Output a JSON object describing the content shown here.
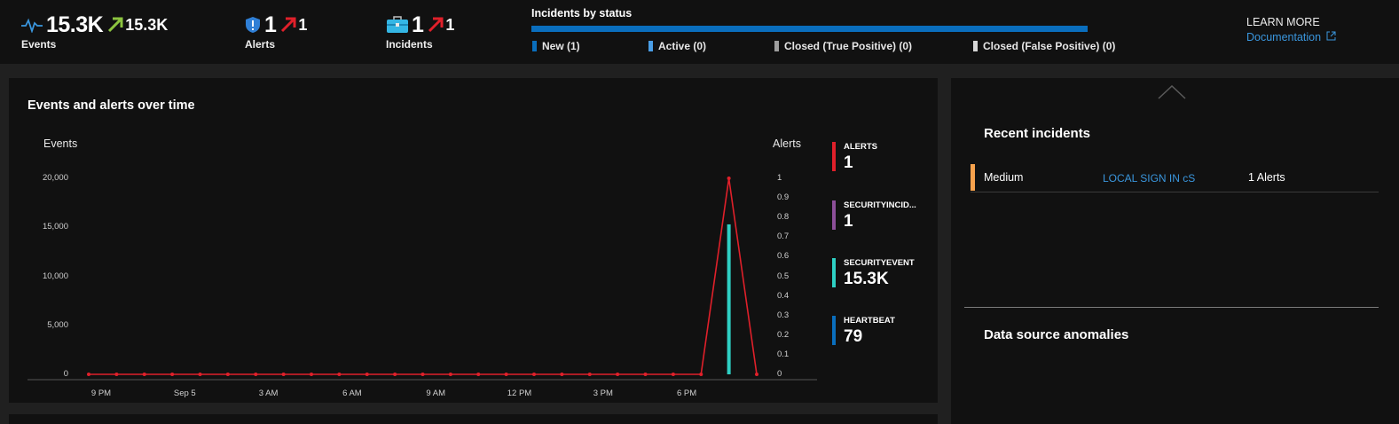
{
  "metrics": {
    "events": {
      "value": "15.3K",
      "delta": "15.3K",
      "label": "Events",
      "icon": "activity-pulse-icon"
    },
    "alerts": {
      "value": "1",
      "delta": "1",
      "label": "Alerts",
      "icon": "shield-alert-icon"
    },
    "incidents": {
      "value": "1",
      "delta": "1",
      "label": "Incidents",
      "icon": "briefcase-icon"
    }
  },
  "incidents_by_status": {
    "title": "Incidents by status",
    "items": [
      {
        "label": "New (1)",
        "color": "#0a6ebd"
      },
      {
        "label": "Active (0)",
        "color": "#4a9ee6"
      },
      {
        "label": "Closed (True Positive) (0)",
        "color": "#9e9e9e"
      },
      {
        "label": "Closed (False Positive) (0)",
        "color": "#d6d6d6"
      }
    ]
  },
  "learn_more": {
    "title": "LEARN MORE",
    "link": "Documentation",
    "icon": "external-link-icon"
  },
  "events_chart": {
    "title": "Events and alerts over time",
    "left_axis_label": "Events",
    "right_axis_label": "Alerts",
    "legend": [
      {
        "name": "ALERTS",
        "value": "1",
        "color": "#e0202a"
      },
      {
        "name": "SECURITYINCID...",
        "value": "1",
        "color": "#8c4f99"
      },
      {
        "name": "SECURITYEVENT",
        "value": "15.3K",
        "color": "#2ed0c4"
      },
      {
        "name": "HEARTBEAT",
        "value": "79",
        "color": "#0a6ebd"
      }
    ]
  },
  "chart_data": {
    "type": "line",
    "title": "Events and alerts over time",
    "ylabel_left": "Events",
    "ylabel_right": "Alerts",
    "x_tick_labels": [
      "9 PM",
      "Sep 5",
      "3 AM",
      "6 AM",
      "9 AM",
      "12 PM",
      "3 PM",
      "6 PM"
    ],
    "left_ticks": [
      "20,000",
      "15,000",
      "10,000",
      "5,000",
      "0"
    ],
    "right_ticks": [
      "1",
      "0.9",
      "0.8",
      "0.7",
      "0.6",
      "0.5",
      "0.4",
      "0.3",
      "0.2",
      "0.1",
      "0"
    ],
    "ylim_left": [
      0,
      20000
    ],
    "ylim_right": [
      0,
      1
    ],
    "grid": false,
    "legend_position": "right",
    "series": [
      {
        "name": "ALERTS",
        "axis": "right",
        "type": "line",
        "color": "#e0202a",
        "values": [
          0,
          0,
          0,
          0,
          0,
          0,
          0,
          0,
          0,
          0,
          0,
          0,
          0,
          0,
          0,
          0,
          0,
          0,
          0,
          0,
          0,
          0,
          0,
          1,
          0
        ]
      },
      {
        "name": "SECURITYEVENT",
        "axis": "left",
        "type": "bar",
        "color": "#2ed0c4",
        "values": [
          0,
          0,
          0,
          0,
          0,
          0,
          0,
          0,
          0,
          0,
          0,
          0,
          0,
          0,
          0,
          0,
          0,
          0,
          0,
          0,
          0,
          0,
          0,
          15300,
          0
        ]
      }
    ]
  },
  "right_panel": {
    "recent_title": "Recent incidents",
    "incident": {
      "severity": "Medium",
      "name": "LOCAL SIGN IN cS",
      "alerts": "1 Alerts"
    },
    "anomalies_title": "Data source anomalies"
  }
}
